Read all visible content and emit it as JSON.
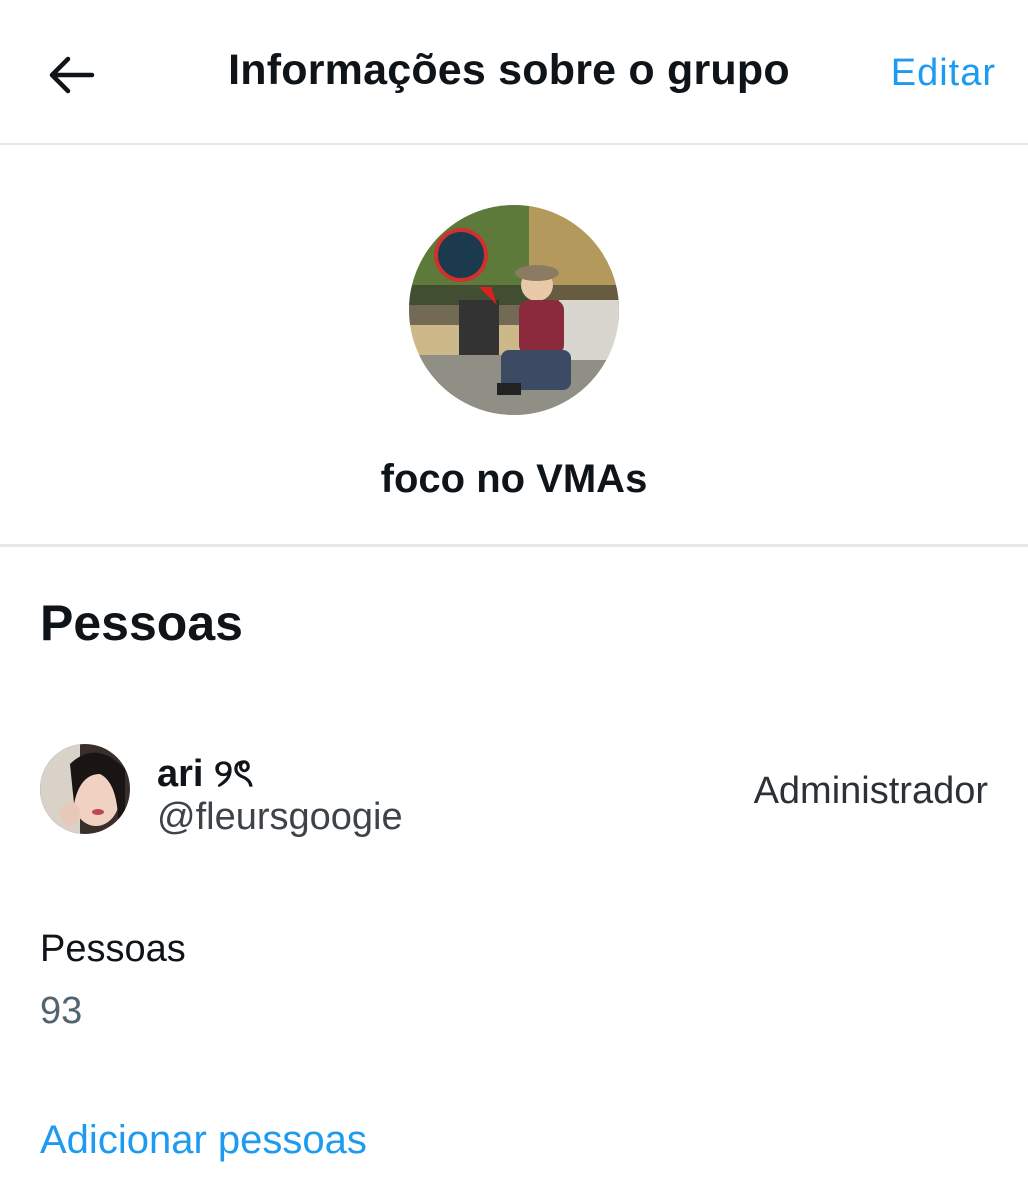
{
  "header": {
    "back_icon": "arrow-left-icon",
    "title": "Informações sobre o grupo",
    "edit_label": "Editar",
    "accent_color": "#1d9bf0"
  },
  "group": {
    "name": "foco no VMAs"
  },
  "people": {
    "section_title": "Pessoas",
    "members": [
      {
        "display_name": "ari ୨ৎ",
        "handle": "@fleursgoogie",
        "role": "Administrador"
      }
    ],
    "count_label": "Pessoas",
    "count_value": "93",
    "add_label": "Adicionar pessoas"
  }
}
